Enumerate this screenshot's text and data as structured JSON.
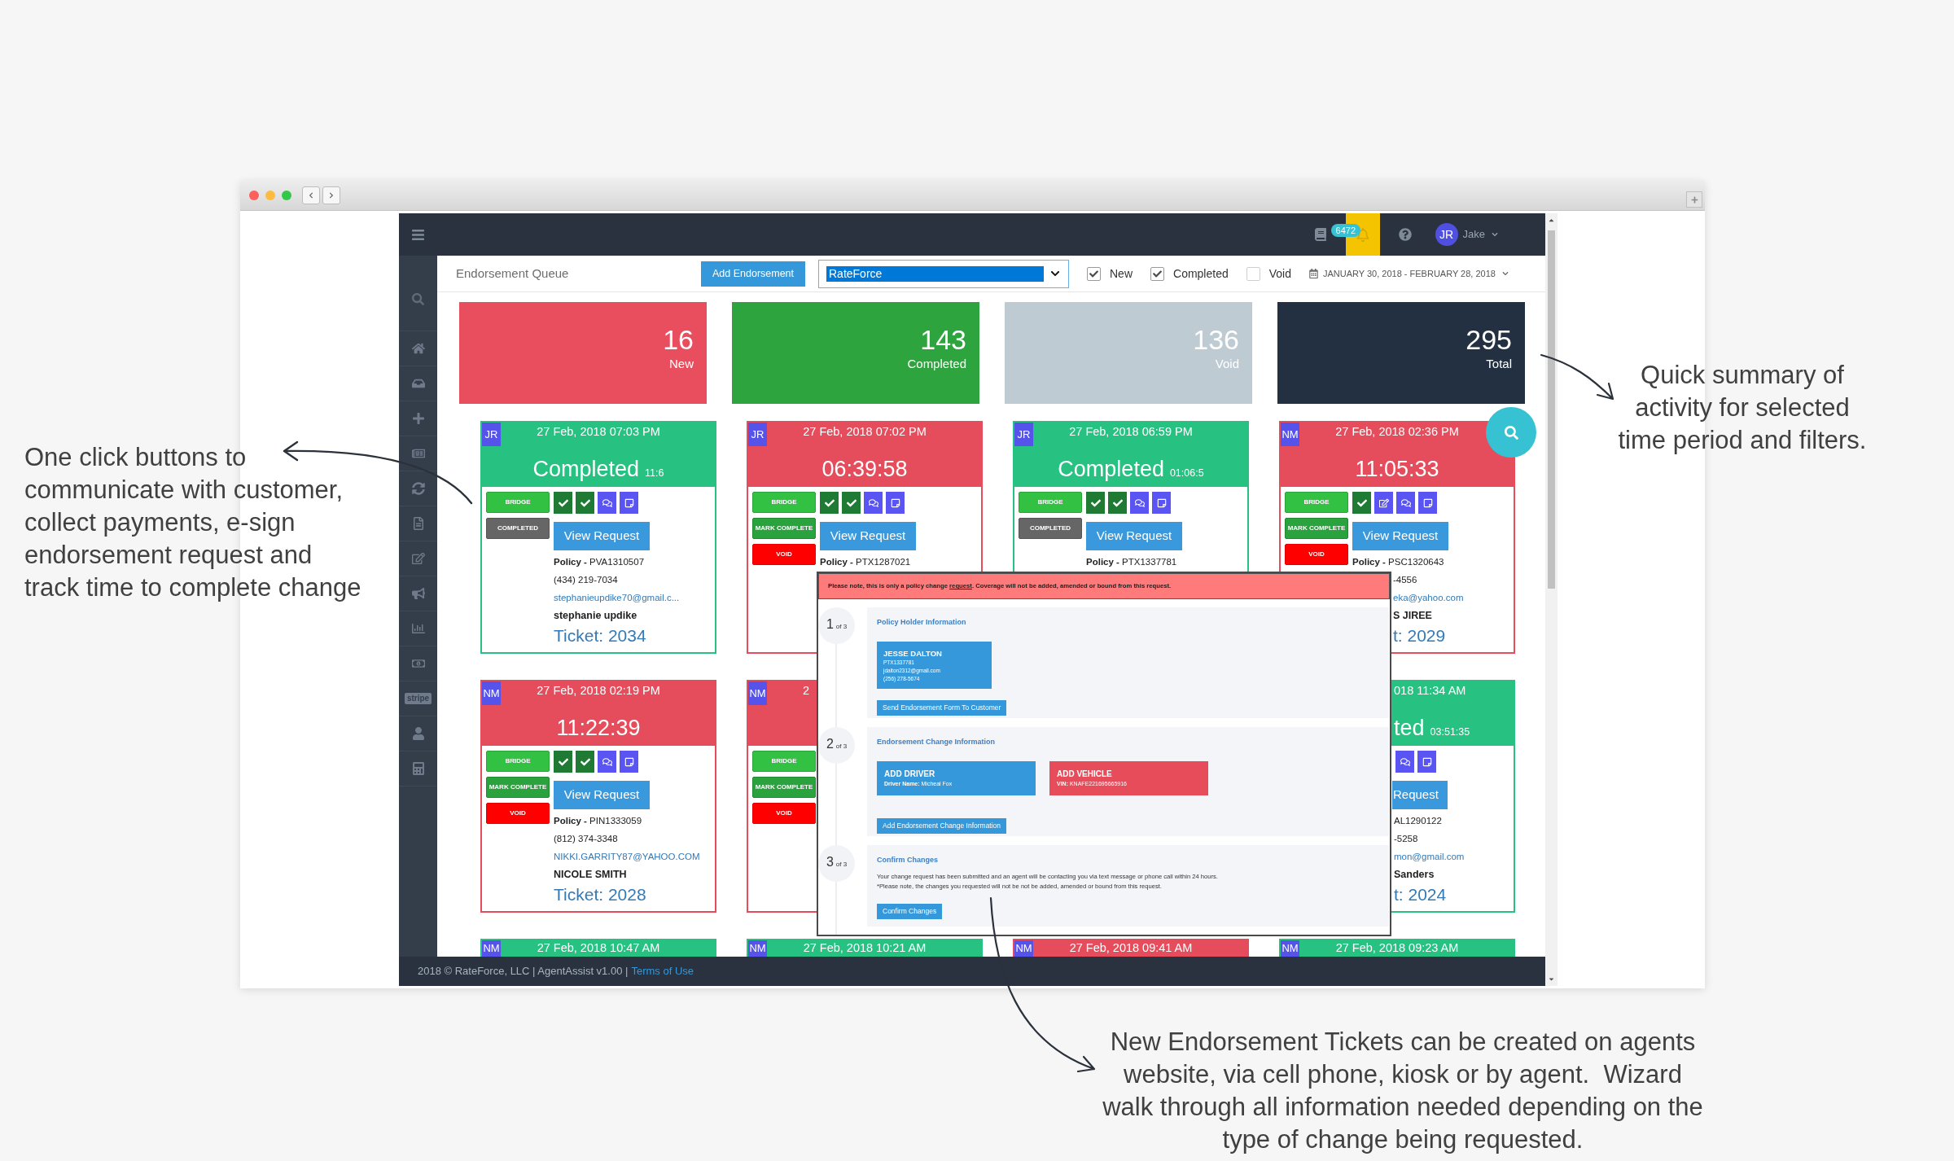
{
  "top_bar": {
    "notification_count": "6472",
    "avatar_initials": "JR",
    "user_name": "Jake"
  },
  "sidebar": {
    "logo_text": "stripe"
  },
  "header": {
    "title": "Endorsement Queue",
    "add_button": "Add Endorsement",
    "agency_select": {
      "value": "RateForce",
      "focused": true
    },
    "filters": [
      {
        "label": "New",
        "checked": true
      },
      {
        "label": "Completed",
        "checked": true
      },
      {
        "label": "Void",
        "checked": false
      }
    ],
    "date_range": "JANUARY 30, 2018 - FEBRUARY 28, 2018"
  },
  "summary": [
    {
      "count": "16",
      "label": "New",
      "color": "#e84e5d"
    },
    {
      "count": "143",
      "label": "Completed",
      "color": "#2ea43f"
    },
    {
      "count": "136",
      "label": "Void",
      "color": "#bfcbd2"
    },
    {
      "count": "295",
      "label": "Total",
      "color": "#223041"
    }
  ],
  "tickets": [
    {
      "kind": "whole",
      "color": "#27c282",
      "agent": "JR",
      "date": "27 Feb, 2018 07:03 PM",
      "status": "Completed",
      "elapsed": "11:6",
      "buttons": [
        {
          "label": "BRIDGE",
          "kind": "bridge"
        },
        {
          "label": "COMPLETED",
          "kind": "completed"
        }
      ],
      "tiles": [
        {
          "kind": "check"
        },
        {
          "kind": "check"
        },
        {
          "kind": "chat"
        },
        {
          "kind": "note"
        }
      ],
      "view_button": "View Request",
      "policy": "**Policy -** PVA1310507",
      "phone": "(434) 219-7034",
      "email": "stephanieupdike70@gmail.c...",
      "name": "stephanie updike",
      "ticket": "Ticket: 2034"
    },
    {
      "kind": "whole",
      "color": "#e64d5c",
      "agent": "JR",
      "date": "27 Feb, 2018 07:02 PM",
      "status": "06:39:58",
      "buttons": [
        {
          "label": "BRIDGE",
          "kind": "bridge"
        },
        {
          "label": "MARK COMPLETE",
          "kind": "mark_complete"
        },
        {
          "label": "VOID",
          "kind": "void"
        }
      ],
      "tiles": [
        {
          "kind": "check"
        },
        {
          "kind": "check"
        },
        {
          "kind": "chat"
        },
        {
          "kind": "note"
        }
      ],
      "view_button": "View Request",
      "policy": "**Policy -** PTX1287021"
    },
    {
      "kind": "whole",
      "color": "#27c282",
      "agent": "JR",
      "date": "27 Feb, 2018 06:59 PM",
      "status": "Completed",
      "elapsed": "01:06:5",
      "buttons": [
        {
          "label": "BRIDGE",
          "kind": "bridge"
        },
        {
          "label": "COMPLETED",
          "kind": "completed"
        }
      ],
      "tiles": [
        {
          "kind": "check"
        },
        {
          "kind": "check"
        },
        {
          "kind": "chat"
        },
        {
          "kind": "note"
        }
      ],
      "view_button": "View Request",
      "policy": "**Policy -** PTX1337781"
    },
    {
      "kind": "right_edge",
      "color": "#e64d5c",
      "agent": "NM",
      "date": "27 Feb, 2018 02:36 PM",
      "status": "11:05:33",
      "buttons": [
        {
          "label": "BRIDGE",
          "kind": "bridge"
        },
        {
          "label": "MARK COMPLETE",
          "kind": "mark_complete"
        },
        {
          "label": "VOID",
          "kind": "void"
        }
      ],
      "tiles": [
        {
          "kind": "check"
        },
        {
          "kind": "edit"
        },
        {
          "kind": "chat"
        },
        {
          "kind": "note"
        }
      ],
      "view_button": "View Request",
      "policy": "**Policy -** PSC1320643",
      "phone": "-4556",
      "email": "eka@yahoo.com",
      "name": "S JIREE",
      "ticket": "t: 2029"
    },
    {
      "kind": "whole",
      "color": "#e64d5c",
      "agent": "NM",
      "date": "27 Feb, 2018 02:19 PM",
      "status": "11:22:39",
      "buttons": [
        {
          "label": "BRIDGE",
          "kind": "bridge"
        },
        {
          "label": "MARK COMPLETE",
          "kind": "mark_complete"
        },
        {
          "label": "VOID",
          "kind": "void"
        }
      ],
      "tiles": [
        {
          "kind": "check"
        },
        {
          "kind": "check"
        },
        {
          "kind": "chat"
        },
        {
          "kind": "note"
        }
      ],
      "view_button": "View Request",
      "policy": "**Policy -** PIN1333059",
      "phone": "(812) 374-3348",
      "email": "NIKKI.GARRITY87@YAHOO.COM",
      "name": "NICOLE SMITH",
      "ticket": "Ticket: 2028"
    },
    {
      "kind": "left_strip",
      "color": "#e64d5c",
      "agent": "NM",
      "date": "2",
      "buttons": [
        {
          "label": "BRIDGE",
          "kind": "bridge"
        },
        {
          "label": "MARK COMPLETE",
          "kind": "mark_complete"
        },
        {
          "label": "VOID",
          "kind": "void"
        }
      ]
    },
    {
      "kind": "right_strip",
      "color": "#27c282",
      "date": "018 11:34 AM",
      "status": "ted",
      "elapsed": "03:51:35",
      "tiles": [
        {
          "kind": "chat"
        },
        {
          "kind": "note"
        }
      ],
      "view_button": "Request",
      "policy": "AL1290122",
      "phone": "-5258",
      "email": "mon@gmail.com",
      "name": "Sanders",
      "ticket": "t: 2024"
    },
    {
      "kind": "top_strip",
      "color": "#27c282",
      "agent": "NM",
      "date": "27 Feb, 2018 10:47 AM"
    },
    {
      "kind": "top_strip",
      "color": "#27c282",
      "agent": "NM",
      "date": "27 Feb, 2018 10:21 AM"
    },
    {
      "kind": "top_strip",
      "color": "#e64d5c",
      "agent": "NM",
      "date": "27 Feb, 2018 09:41 AM"
    },
    {
      "kind": "top_strip",
      "color": "#27c282",
      "agent": "NM",
      "date": "27 Feb, 2018 09:23 AM"
    }
  ],
  "modal": {
    "notice": {
      "before": "Please note, this is only a policy change ",
      "link": "request",
      "after": ". Coverage will not be added, amended or bound from this request."
    },
    "steps": [
      {
        "kind": "holder",
        "number": "1",
        "total": "of 3",
        "title": "Policy Holder Information",
        "holder": {
          "name": "JESSE DALTON",
          "details": [
            "PTX1337781",
            "jdalton2312@gmail.com",
            "(256) 278-5674"
          ]
        },
        "button": "Send Endorsement Form To Customer"
      },
      {
        "kind": "changes",
        "number": "2",
        "total": "of 3",
        "title": "Endorsement Change Information",
        "changes": [
          {
            "title": "ADD DRIVER",
            "detail": "**Driver Name:** Micheal Fox",
            "color": "#3498db"
          },
          {
            "title": "ADD VEHICLE",
            "detail": "**VIN:** KNAFE221695665916",
            "color": "#e74c5b"
          }
        ],
        "button": "Add Endorsement Change Information"
      },
      {
        "kind": "confirm",
        "number": "3",
        "total": "of 3",
        "title": "Confirm Changes",
        "lines": [
          "Your change request has been submitted and an agent will be contacting you via text message or phone call within 24 hours.",
          "*Please note, the changes you requested will not be not be added, amended or bound from this request."
        ],
        "button": "Confirm Changes"
      }
    ]
  },
  "footer": {
    "text": "2018 © RateForce, LLC | AgentAssist v1.00 |",
    "link": "Terms of Use"
  },
  "callouts": {
    "left": "One click buttons to communicate with customer, collect payments, e-sign endorsement request and track time to complete change",
    "right": "Quick summary of activity for selected time period and filters.",
    "bottom": "New Endorsement Tickets can be created on agents website, via cell phone, kiosk or by agent.  Wizard walk through all information needed depending on the type of change being requested."
  }
}
